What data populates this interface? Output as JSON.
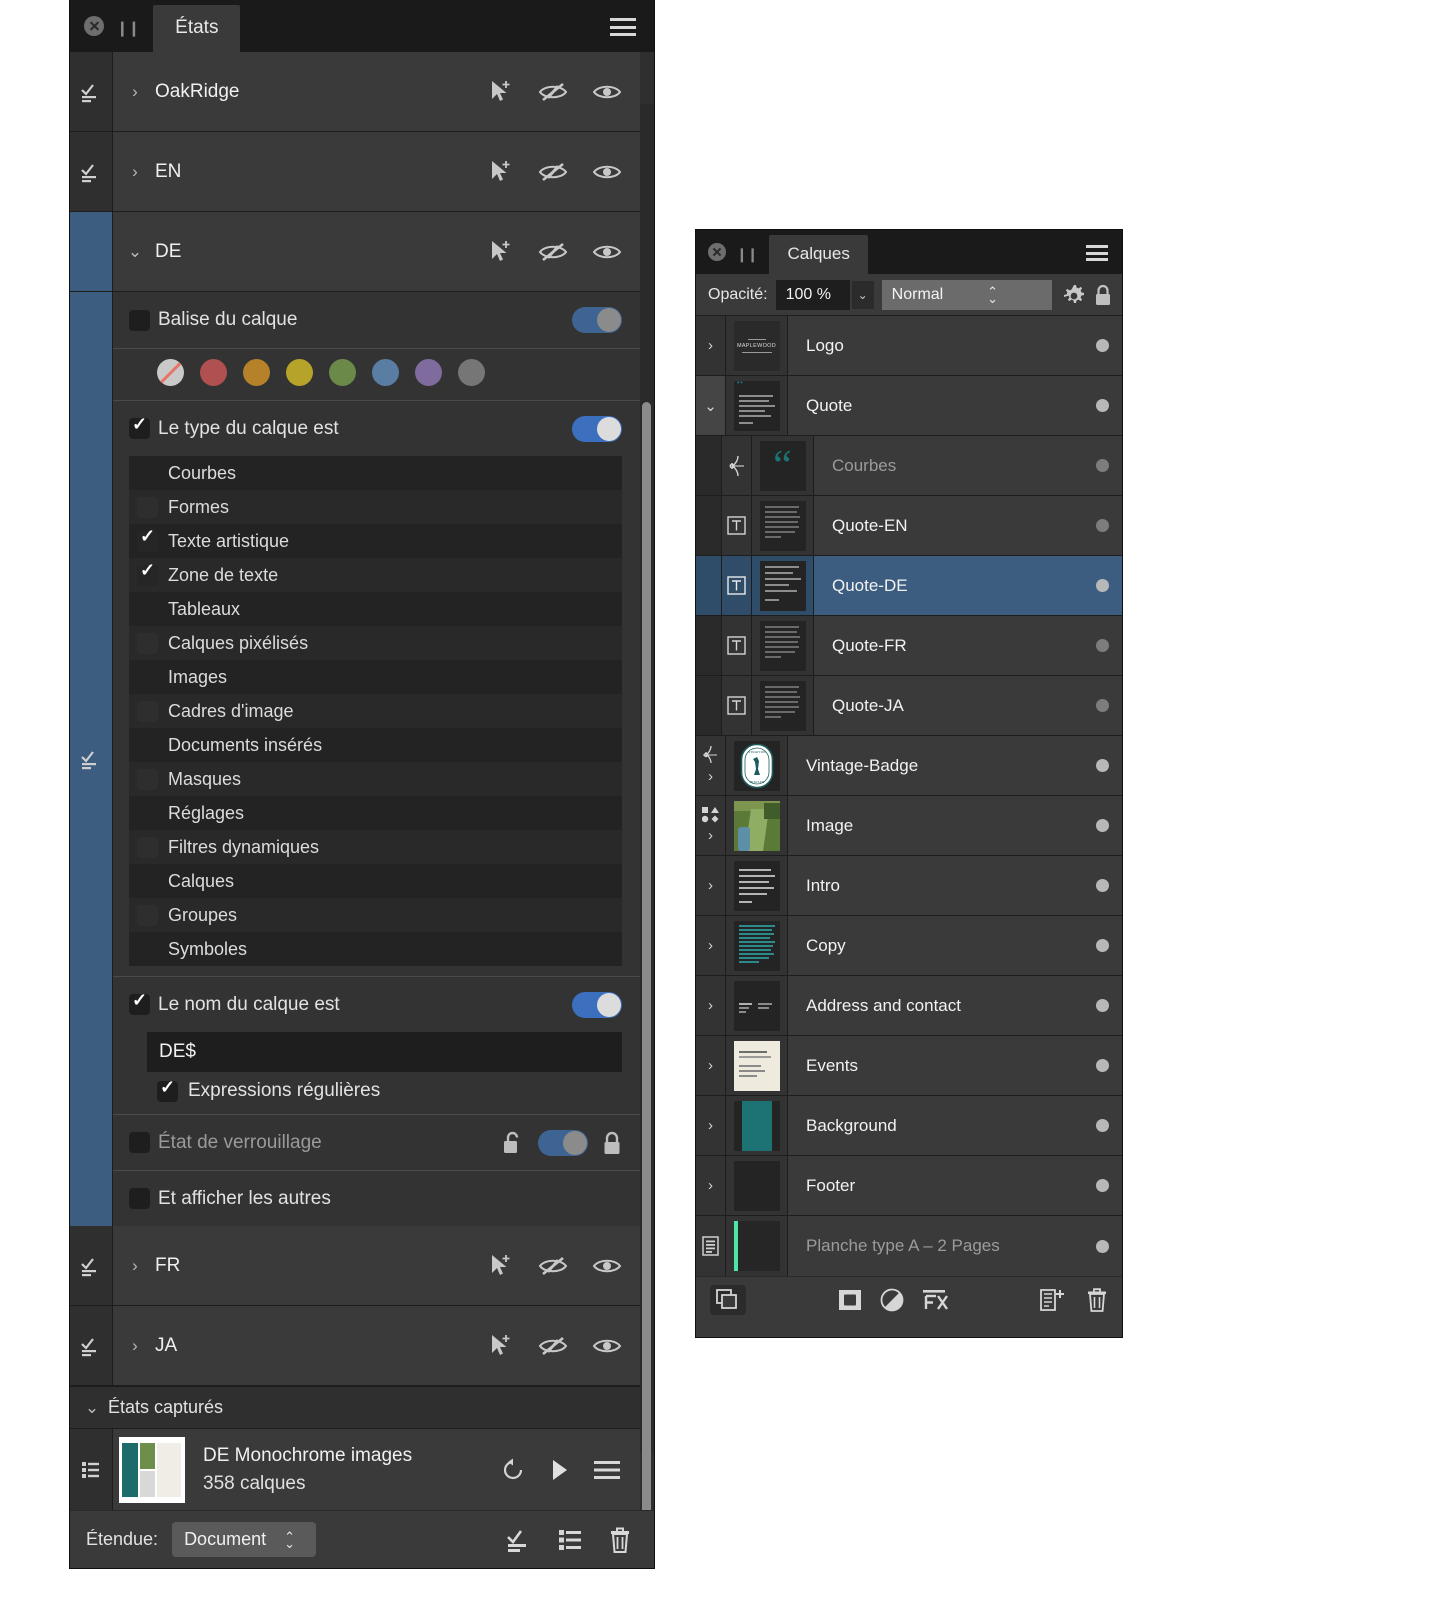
{
  "states_panel": {
    "title": "États",
    "close_icon": "close-icon",
    "grip_icon": "grip-icon",
    "menu_icon": "hamburger-menu-icon",
    "state_groups": [
      {
        "name": "OakRidge",
        "expanded": false,
        "chevron": "›",
        "selected": false
      },
      {
        "name": "EN",
        "expanded": false,
        "chevron": "›",
        "selected": false
      },
      {
        "name": "DE",
        "expanded": true,
        "chevron": "⌄",
        "selected": true
      },
      {
        "name": "FR",
        "expanded": false,
        "chevron": "›",
        "selected": false
      },
      {
        "name": "JA",
        "expanded": false,
        "chevron": "›",
        "selected": false
      }
    ],
    "row_icons": [
      "cursor-add-icon",
      "eye-hidden-icon",
      "eye-visible-icon"
    ],
    "criteria": {
      "tag": {
        "label": "Balise du calque",
        "checked": false,
        "toggle": "on-muted"
      },
      "swatches": [
        {
          "name": "none",
          "color": "#c9c9c9"
        },
        {
          "name": "red",
          "color": "#b05050"
        },
        {
          "name": "orange",
          "color": "#b5822a"
        },
        {
          "name": "yellow",
          "color": "#b5a32a"
        },
        {
          "name": "green",
          "color": "#6b8a4a"
        },
        {
          "name": "blue",
          "color": "#5a7ea3"
        },
        {
          "name": "purple",
          "color": "#7f6b9e"
        },
        {
          "name": "grey",
          "color": "#767676"
        }
      ],
      "layer_type": {
        "label": "Le type du calque est",
        "checked": true,
        "toggle": "on"
      },
      "type_options": [
        {
          "label": "Courbes",
          "checked": false,
          "box": "none"
        },
        {
          "label": "Formes",
          "checked": false,
          "box": "empty"
        },
        {
          "label": "Texte artistique",
          "checked": true,
          "box": "checked"
        },
        {
          "label": "Zone de texte",
          "checked": true,
          "box": "checked"
        },
        {
          "label": "Tableaux",
          "checked": false,
          "box": "none"
        },
        {
          "label": "Calques pixélisés",
          "checked": false,
          "box": "empty"
        },
        {
          "label": "Images",
          "checked": false,
          "box": "none"
        },
        {
          "label": "Cadres d'image",
          "checked": false,
          "box": "empty"
        },
        {
          "label": "Documents insérés",
          "checked": false,
          "box": "none"
        },
        {
          "label": "Masques",
          "checked": false,
          "box": "empty"
        },
        {
          "label": "Réglages",
          "checked": false,
          "box": "none"
        },
        {
          "label": "Filtres dynamiques",
          "checked": false,
          "box": "empty"
        },
        {
          "label": "Calques",
          "checked": false,
          "box": "none"
        },
        {
          "label": "Groupes",
          "checked": false,
          "box": "empty"
        },
        {
          "label": "Symboles",
          "checked": false,
          "box": "none"
        }
      ],
      "layer_name": {
        "label": "Le nom du calque est",
        "checked": true,
        "toggle": "on"
      },
      "name_value": "DE$",
      "regex": {
        "label": "Expressions régulières",
        "checked": true
      },
      "lock_state": {
        "label": "État de verrouillage",
        "checked": false,
        "toggle": "on-muted",
        "unlock_icon": "unlock-icon",
        "lock_icon": "lock-icon"
      },
      "show_others": {
        "label": "Et afficher les autres",
        "checked": false
      }
    },
    "captured": {
      "header": "États capturés",
      "header_chevron": "⌄",
      "items": [
        {
          "title": "DE Monochrome images",
          "subtitle": "358 calques",
          "icons": [
            "reset-icon",
            "play-icon",
            "hamburger-menu-icon"
          ]
        }
      ]
    },
    "footer": {
      "scope_label": "Étendue:",
      "scope_value": "Document",
      "icons": [
        "add-state-icon",
        "list-icon",
        "trash-icon"
      ]
    }
  },
  "layers_panel": {
    "title": "Calques",
    "close_icon": "close-icon",
    "grip_icon": "grip-icon",
    "menu_icon": "hamburger-menu-icon",
    "opacity": {
      "label": "Opacité:",
      "value": "100 %",
      "dropdown_icon": "chevron-down-icon",
      "blend_mode": "Normal",
      "blend_stepper_icon": "stepper-icon",
      "gear_icon": "gear-icon",
      "lock_icon": "lock-icon"
    },
    "layers": [
      {
        "name": "Logo",
        "chevron": "›",
        "indent": 0,
        "selected": false,
        "dim": false,
        "thumb": "logo",
        "badge": ""
      },
      {
        "name": "Quote",
        "chevron": "⌄",
        "indent": 0,
        "selected": false,
        "dim": false,
        "thumb": "textblock",
        "badge": ""
      },
      {
        "name": "Courbes",
        "chevron": "",
        "indent": 1,
        "selected": false,
        "dim": true,
        "thumb": "quote",
        "badge": "curves-icon"
      },
      {
        "name": "Quote-EN",
        "chevron": "",
        "indent": 1,
        "selected": false,
        "dim": false,
        "thumb": "textsmall",
        "badge": "text-frame-icon"
      },
      {
        "name": "Quote-DE",
        "chevron": "",
        "indent": 1,
        "selected": true,
        "dim": false,
        "thumb": "textlines",
        "badge": "text-frame-icon"
      },
      {
        "name": "Quote-FR",
        "chevron": "",
        "indent": 1,
        "selected": false,
        "dim": false,
        "thumb": "textsmall",
        "badge": "text-frame-icon"
      },
      {
        "name": "Quote-JA",
        "chevron": "",
        "indent": 1,
        "selected": false,
        "dim": false,
        "thumb": "textsmall",
        "badge": "text-frame-icon"
      },
      {
        "name": "Vintage-Badge",
        "chevron": "›",
        "indent": 0,
        "selected": false,
        "dim": false,
        "thumb": "badge",
        "badge": "curves-icon"
      },
      {
        "name": "Image",
        "chevron": "›",
        "indent": 0,
        "selected": false,
        "dim": false,
        "thumb": "photo",
        "badge": "shapes-icon"
      },
      {
        "name": "Intro",
        "chevron": "›",
        "indent": 0,
        "selected": false,
        "dim": false,
        "thumb": "greylines",
        "badge": ""
      },
      {
        "name": "Copy",
        "chevron": "›",
        "indent": 0,
        "selected": false,
        "dim": false,
        "thumb": "tealtext",
        "badge": ""
      },
      {
        "name": "Address and contact",
        "chevron": "›",
        "indent": 0,
        "selected": false,
        "dim": false,
        "thumb": "address",
        "badge": ""
      },
      {
        "name": "Events",
        "chevron": "›",
        "indent": 0,
        "selected": false,
        "dim": false,
        "thumb": "cream",
        "badge": ""
      },
      {
        "name": "Background",
        "chevron": "›",
        "indent": 0,
        "selected": false,
        "dim": false,
        "thumb": "tealfill",
        "badge": ""
      },
      {
        "name": "Footer",
        "chevron": "›",
        "indent": 0,
        "selected": false,
        "dim": false,
        "thumb": "dark",
        "badge": ""
      },
      {
        "name": "Planche type A – 2 Pages",
        "chevron": "",
        "indent": 0,
        "selected": false,
        "dim": true,
        "thumb": "master",
        "badge": "master-page-icon"
      }
    ],
    "footer_icons": [
      "group-layers-icon",
      "mask-icon",
      "adjustment-icon",
      "fx-icon",
      "add-layer-icon",
      "trash-icon"
    ]
  },
  "colors": {
    "panel_bg": "#3a3a3a",
    "panel_dark": "#2f2f2f",
    "titlebar": "#1a1a1a",
    "selection_blue": "#3d5d80",
    "toggle_blue": "#3c6fbd",
    "teal": "#1d7373",
    "master_green": "#4ee6a8"
  }
}
